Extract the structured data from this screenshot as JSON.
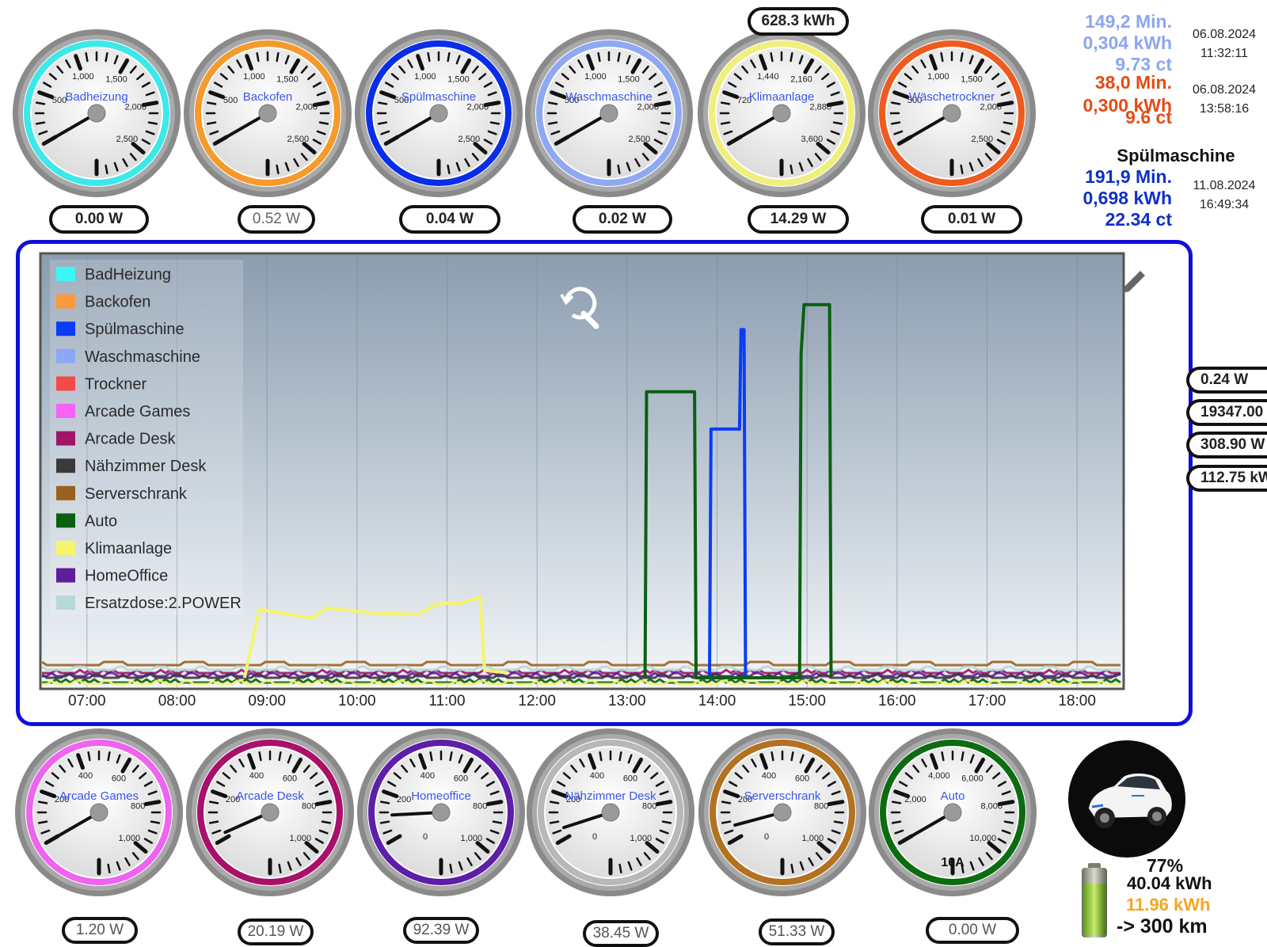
{
  "colors": {
    "badheizung": "#3de8e8",
    "backofen": "#f59a2c",
    "spuelmaschine": "#0a2de8",
    "waschmaschine": "#8fa8f2",
    "trockner": "#ef5a1e",
    "klimaanlage": "#f0ef7e",
    "arcade_games": "#ef63ef",
    "arcade_desk": "#a8106a",
    "homeoffice": "#5d1ea8",
    "naehzimmer": "#b8b8b8",
    "serverschrank": "#b27220",
    "auto": "#0c6c10",
    "frame": "#1010d8"
  },
  "top_gauges": [
    {
      "label": "Badheizung",
      "ticks": [
        "500",
        "1,000",
        "1,500",
        "2,000",
        "2,500"
      ],
      "value_text": "0.00 W",
      "ring": "#3de8e8",
      "fraction": 0.0
    },
    {
      "label": "Backofen",
      "ticks": [
        "500",
        "1,000",
        "1,500",
        "2,000",
        "2,500"
      ],
      "value_text": "0.52 W",
      "ring": "#f59a2c",
      "fraction": 0.0
    },
    {
      "label": "Spülmaschine",
      "ticks": [
        "500",
        "1,000",
        "1,500",
        "2,000",
        "2,500"
      ],
      "value_text": "0.04 W",
      "ring": "#0a2de8",
      "fraction": 0.0
    },
    {
      "label": "Waschmaschine",
      "ticks": [
        "500",
        "1,000",
        "1,500",
        "2,000",
        "2,500"
      ],
      "value_text": "0.02 W",
      "ring": "#8fa8f2",
      "fraction": 0.0
    },
    {
      "label": "Klimaanlage",
      "ticks": [
        "720",
        "1,440",
        "2,160",
        "2,880",
        "3,600"
      ],
      "value_text": "14.29 W",
      "ring": "#f0ef7e",
      "fraction": 0.0
    },
    {
      "label": "Wäschetrockner",
      "ticks": [
        "500",
        "1,000",
        "1,500",
        "2,000",
        "2,500"
      ],
      "value_text": "0.01 W",
      "ring": "#ef5a1e",
      "fraction": 0.0
    }
  ],
  "bottom_gauges": [
    {
      "label": "Arcade Games",
      "ticks": [
        "200",
        "400",
        "600",
        "800",
        "1,000"
      ],
      "value_text": "1.20 W",
      "ring": "#ef63ef",
      "fraction": 0.0
    },
    {
      "label": "Arcade Desk",
      "ticks": [
        "200",
        "400",
        "600",
        "800",
        "1,000"
      ],
      "value_text": "20.19 W",
      "ring": "#a8106a",
      "fraction": 0.02
    },
    {
      "label": "Homeoffice",
      "ticks": [
        "200",
        "400",
        "600",
        "800",
        "1,000"
      ],
      "value_text": "92.39 W",
      "ring": "#5d1ea8",
      "fraction": 0.09
    },
    {
      "label": "Nähzimmer Desk",
      "ticks": [
        "200",
        "400",
        "600",
        "800",
        "1,000"
      ],
      "value_text": "38.45 W",
      "ring": "#b8b8b8",
      "fraction": 0.04
    },
    {
      "label": "Serverschrank",
      "ticks": [
        "200",
        "400",
        "600",
        "800",
        "1,000"
      ],
      "value_text": "51.33 W",
      "ring": "#b27220",
      "fraction": 0.05
    },
    {
      "label": "Auto",
      "ticks": [
        "2,000",
        "4,000",
        "6,000",
        "8,000",
        "10,000"
      ],
      "value_text": "0.00 W",
      "ring": "#0c6c10",
      "fraction": 0.0
    }
  ],
  "gauge_zero_label": "0",
  "auto_current": "16A",
  "klima_total": "628.3 kWh",
  "right_stats": {
    "waschmaschine": {
      "minutes": "149,2 Min.",
      "kwh": "0,304 kWh",
      "cost": "9.73 ct",
      "date": "06.08.2024",
      "time": "11:32:11"
    },
    "trockner": {
      "minutes": "38,0 Min.",
      "kwh": "0,300 kWh",
      "cost": "9.6 ct",
      "date": "06.08.2024",
      "time": "13:58:16"
    },
    "spuelmaschine": {
      "title": "Spülmaschine",
      "minutes": "191,9 Min.",
      "kwh": "0,698 kWh",
      "cost": "22.34 ct",
      "date": "11.08.2024",
      "time": "16:49:34"
    }
  },
  "side_values": [
    "0.24 W",
    "19347.00",
    "308.90 W",
    "112.75 kWh"
  ],
  "car": {
    "percent": "77%",
    "energy": "40.04 kWh",
    "range_energy": "11.96 kWh",
    "range": "-> 300 km",
    "battery_level": 0.77
  },
  "chart_data": {
    "type": "line",
    "x_labels": [
      "07:00",
      "08:00",
      "09:00",
      "10:00",
      "11:00",
      "12:00",
      "13:00",
      "14:00",
      "15:00",
      "16:00",
      "17:00",
      "18:00"
    ],
    "series": [
      {
        "name": "BadHeizung",
        "color": "#3cf5f5"
      },
      {
        "name": "Backofen",
        "color": "#f99a3c"
      },
      {
        "name": "Spülmaschine",
        "color": "#0a3cf5",
        "points": [
          [
            "13:55",
            0
          ],
          [
            "13:56",
            2000
          ],
          [
            "14:15",
            2000
          ],
          [
            "14:16",
            2800
          ],
          [
            "14:18",
            2800
          ],
          [
            "14:19",
            0
          ]
        ]
      },
      {
        "name": "Waschmaschine",
        "color": "#8da6f5"
      },
      {
        "name": "Trockner",
        "color": "#f54848"
      },
      {
        "name": "Arcade Games",
        "color": "#f563f5"
      },
      {
        "name": "Arcade Desk",
        "color": "#a01566"
      },
      {
        "name": "Nähzimmer Desk",
        "color": "#3a3a3a"
      },
      {
        "name": "Serverschrank",
        "color": "#9a6020"
      },
      {
        "name": "Auto",
        "color": "#0a6010",
        "points": [
          [
            "13:12",
            0
          ],
          [
            "13:13",
            2300
          ],
          [
            "13:45",
            2300
          ],
          [
            "13:46",
            0
          ],
          [
            "14:55",
            0
          ],
          [
            "14:56",
            2600
          ],
          [
            "14:58",
            3000
          ],
          [
            "15:15",
            3000
          ],
          [
            "15:16",
            0
          ]
        ]
      },
      {
        "name": "Klimaanlage",
        "color": "#f5f56c",
        "points": [
          [
            "08:45",
            0
          ],
          [
            "08:55",
            550
          ],
          [
            "09:30",
            480
          ],
          [
            "09:40",
            560
          ],
          [
            "10:10",
            520
          ],
          [
            "10:40",
            510
          ],
          [
            "10:55",
            600
          ],
          [
            "11:10",
            600
          ],
          [
            "11:22",
            650
          ],
          [
            "11:25",
            60
          ],
          [
            "11:40",
            40
          ]
        ]
      },
      {
        "name": "HomeOffice",
        "color": "#5e1d9a"
      },
      {
        "name": "Ersatzdose:2.POWER",
        "color": "#b6d8d8"
      }
    ],
    "x_range": [
      "06:30",
      "18:30"
    ],
    "y_range": [
      0,
      3400
    ],
    "grid": true,
    "legend_position": "top-left"
  }
}
